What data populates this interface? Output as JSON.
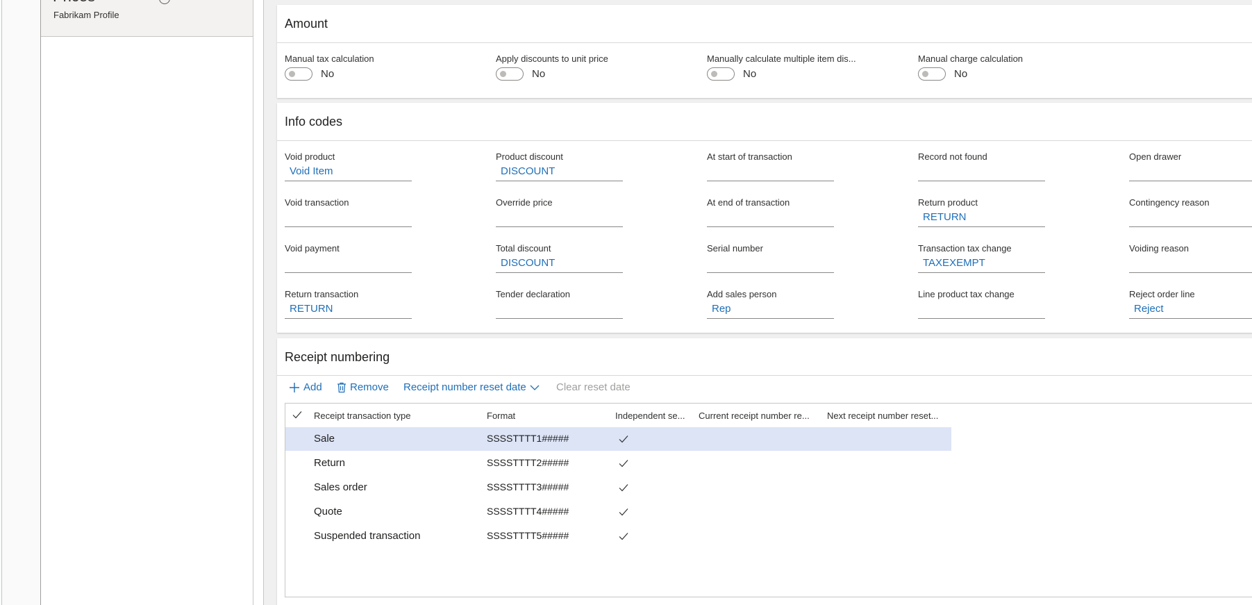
{
  "left_panel": {
    "profile_title": "Prices",
    "profile_subtitle": "Fabrikam Profile"
  },
  "amount": {
    "title": "Amount",
    "fields": [
      {
        "label": "Manual tax calculation",
        "value": "No"
      },
      {
        "label": "Apply discounts to unit price",
        "value": "No"
      },
      {
        "label": "Manually calculate multiple item dis...",
        "value": "No"
      },
      {
        "label": "Manual charge calculation",
        "value": "No"
      }
    ]
  },
  "info_codes": {
    "title": "Info codes",
    "rows": [
      [
        {
          "label": "Void product",
          "value": "Void Item"
        },
        {
          "label": "Product discount",
          "value": "DISCOUNT"
        },
        {
          "label": "At start of transaction",
          "value": ""
        },
        {
          "label": "Record not found",
          "value": ""
        },
        {
          "label": "Open drawer",
          "value": ""
        }
      ],
      [
        {
          "label": "Void transaction",
          "value": ""
        },
        {
          "label": "Override price",
          "value": ""
        },
        {
          "label": "At end of transaction",
          "value": ""
        },
        {
          "label": "Return product",
          "value": "RETURN"
        },
        {
          "label": "Contingency reason",
          "value": ""
        }
      ],
      [
        {
          "label": "Void payment",
          "value": ""
        },
        {
          "label": "Total discount",
          "value": "DISCOUNT"
        },
        {
          "label": "Serial number",
          "value": ""
        },
        {
          "label": "Transaction tax change",
          "value": "TAXEXEMPT"
        },
        {
          "label": "Voiding reason",
          "value": ""
        }
      ],
      [
        {
          "label": "Return transaction",
          "value": "RETURN"
        },
        {
          "label": "Tender declaration",
          "value": ""
        },
        {
          "label": "Add sales person",
          "value": "Rep"
        },
        {
          "label": "Line product tax change",
          "value": ""
        },
        {
          "label": "Reject order line",
          "value": "Reject"
        }
      ]
    ]
  },
  "receipt_numbering": {
    "title": "Receipt numbering",
    "toolbar": {
      "add": "Add",
      "remove": "Remove",
      "reset_date": "Receipt number reset date",
      "clear_reset": "Clear reset date"
    },
    "columns": [
      "Receipt transaction type",
      "Format",
      "Independent se...",
      "Current receipt number re...",
      "Next receipt number reset..."
    ],
    "rows": [
      {
        "type": "Sale",
        "format": "SSSSTTTT1#####",
        "independent": true,
        "selected": true
      },
      {
        "type": "Return",
        "format": "SSSSTTTT2#####",
        "independent": true,
        "selected": false
      },
      {
        "type": "Sales order",
        "format": "SSSSTTTT3#####",
        "independent": true,
        "selected": false
      },
      {
        "type": "Quote",
        "format": "SSSSTTTT4#####",
        "independent": true,
        "selected": false
      },
      {
        "type": "Suspended transaction",
        "format": "SSSSTTTT5#####",
        "independent": true,
        "selected": false
      }
    ]
  },
  "colors": {
    "link": "#1f6fb8",
    "selected_row": "#dce4f6",
    "panel_bg": "#f0f0f0"
  },
  "icons": {
    "add": "plus-icon",
    "remove": "trash-icon",
    "reset": "chevron-down-icon",
    "check": "checkmark-icon"
  }
}
